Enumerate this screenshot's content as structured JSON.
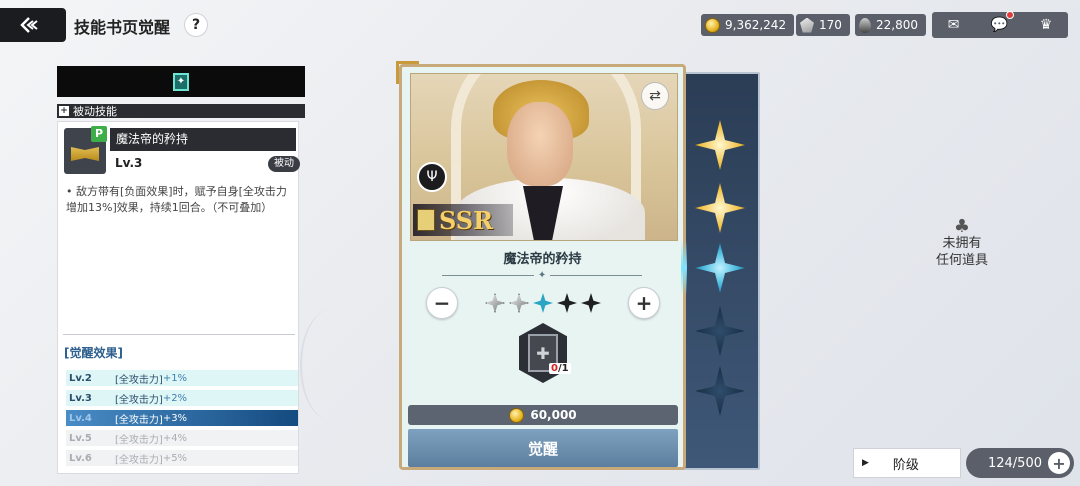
{
  "header": {
    "title": "技能书页觉醒",
    "help_label": "?"
  },
  "currencies": [
    {
      "name": "gold",
      "icon": "coin-icon",
      "value": "9,362,242"
    },
    {
      "name": "stone",
      "icon": "stone-icon",
      "value": "170"
    },
    {
      "name": "drop",
      "icon": "drop-icon",
      "value": "22,800"
    }
  ],
  "top_icons": {
    "mail": "mail-icon",
    "chat": "chat-icon",
    "rank": "rank-icon"
  },
  "left_panel": {
    "section_label": "被动技能",
    "skill": {
      "name": "魔法帝的矜持",
      "level": "Lv.3",
      "type_tag": "被动",
      "badge": "P",
      "description": "• 敌方带有[负面效果]时，赋予自身[全攻击力增加13%]效果，持续1回合。（不可叠加）"
    },
    "awaken_title": "[觉醒效果]",
    "awaken_rows": [
      {
        "lv": "Lv.2",
        "attr": "[全攻击力]",
        "val": "+1%",
        "state": "unlocked"
      },
      {
        "lv": "Lv.3",
        "attr": "[全攻击力]",
        "val": "+2%",
        "state": "unlocked"
      },
      {
        "lv": "Lv.4",
        "attr": "[全攻击力]",
        "val": "+3%",
        "state": "current"
      },
      {
        "lv": "Lv.5",
        "attr": "[全攻击力]",
        "val": "+4%",
        "state": "locked"
      },
      {
        "lv": "Lv.6",
        "attr": "[全攻击力]",
        "val": "+5%",
        "state": "locked"
      }
    ]
  },
  "card": {
    "rarity": "SSR",
    "skill_name": "魔法帝的矜持",
    "stars": {
      "filled": 2,
      "current": 1,
      "total": 5
    },
    "material": {
      "have": "0",
      "need": "/1"
    },
    "cost": "60,000",
    "awaken_label": "觉醒"
  },
  "right_panel": {
    "empty_line1": "未拥有",
    "empty_line2": "任何道具",
    "rank_label": "阶级",
    "capacity": "124/500"
  },
  "colors": {
    "accent": "#2aa6c4",
    "gold": "#f1c040",
    "dark_bar": "#5a5f69"
  }
}
